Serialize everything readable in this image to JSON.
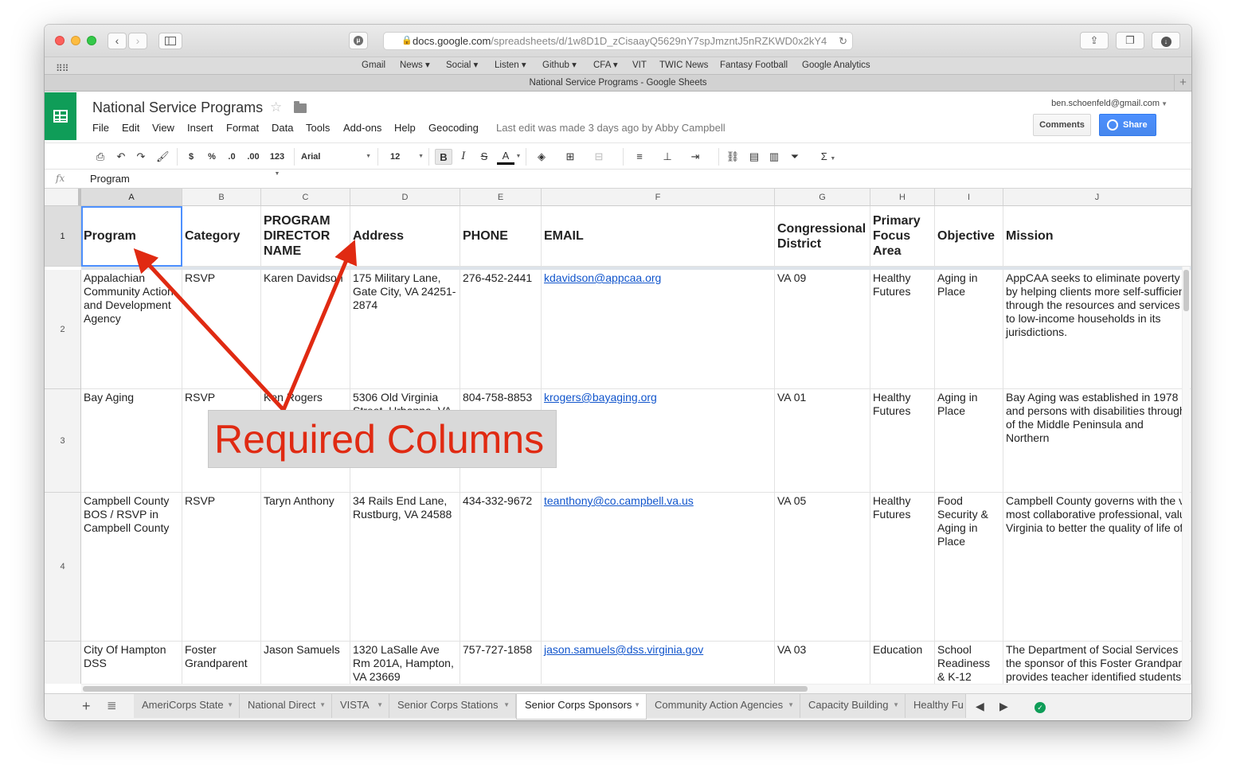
{
  "browser": {
    "url_host": "docs.google.com",
    "url_path": "/spreadsheets/d/1w8D1D_zCisaayQ5629nY7spJmzntJ5nRZKWD0x2kY4",
    "tab_title": "National Service Programs - Google Sheets",
    "bookmarks": [
      "Gmail",
      "News ▾",
      "Social ▾",
      "Listen ▾",
      "Github ▾",
      "CFA ▾",
      "VIT",
      "TWIC News",
      "Fantasy Football",
      "Google Analytics"
    ]
  },
  "doc": {
    "title": "National Service Programs",
    "menus": [
      "File",
      "Edit",
      "View",
      "Insert",
      "Format",
      "Data",
      "Tools",
      "Add-ons",
      "Help",
      "Geocoding"
    ],
    "last_edit": "Last edit was made 3 days ago by Abby Campbell",
    "account": "ben.schoenfeld@gmail.com",
    "comments_label": "Comments",
    "share_label": "Share"
  },
  "toolbar": {
    "currency": "$",
    "percent": "%",
    "dec_less": ".0",
    "dec_more": ".00",
    "format_more": "123",
    "font": "Arial",
    "font_size": "12",
    "bold": "B",
    "italic": "I",
    "strike": "S",
    "text_color": "A",
    "sigma": "Σ"
  },
  "formula_bar": {
    "fx": "fx",
    "value": "Program"
  },
  "grid": {
    "columns": [
      "A",
      "B",
      "C",
      "D",
      "E",
      "F",
      "G",
      "H",
      "I",
      "J"
    ],
    "row_numbers": [
      "1",
      "2",
      "3",
      "4"
    ],
    "headers": [
      "Program",
      "Category",
      "PROGRAM DIRECTOR NAME",
      "Address",
      "PHONE",
      "EMAIL",
      "Congressional District",
      "Primary Focus Area",
      "Objective",
      "Mission"
    ],
    "rows": [
      [
        "Appalachian Community Action and Development Agency",
        "RSVP",
        "Karen Davidson",
        "175 Military Lane, Gate City, VA 24251-2874",
        "276-452-2441",
        "kdavidson@appcaa.org",
        "VA 09",
        "Healthy Futures",
        "Aging in Place",
        "AppCAA seeks to eliminate poverty by helping clients more self-sufficient through the resources and services to low-income households in its jurisdictions."
      ],
      [
        "Bay Aging",
        "RSVP",
        "Ken Rogers",
        "5306 Old Virginia Street, Urbanna, VA",
        "804-758-8853",
        "krogers@bayaging.org",
        "VA 01",
        "Healthy Futures",
        "Aging in Place",
        "Bay Aging was established in 1978 and persons with disabilities through of the Middle Peninsula and Northern"
      ],
      [
        "Campbell County BOS  /  RSVP in Campbell County",
        "RSVP",
        "Taryn Anthony",
        "34 Rails End Lane, Rustburg, VA 24588",
        "434-332-9672",
        "teanthony@co.campbell.va.us",
        "VA 05",
        "Healthy Futures",
        "Food Security & Aging in Place",
        "Campbell County governs with the v most collaborative professional, valu Virginia to better the quality of life of"
      ],
      [
        "City Of Hampton DSS",
        "Foster Grandparent",
        "Jason Samuels",
        "1320 LaSalle Ave Rm 201A, Hampton, VA 23669",
        "757-727-1858",
        "jason.samuels@dss.virginia.gov",
        "VA 03",
        "Education",
        "School Readiness & K-12",
        "The Department of Social Services the sponsor of this Foster Grandpar provides teacher identified students"
      ]
    ]
  },
  "sheet_tabs": [
    "AmeriCorps State",
    "National Direct",
    "VISTA",
    "Senior Corps Stations",
    "Senior Corps Sponsors",
    "Community Action Agencies",
    "Capacity Building",
    "Healthy Fu"
  ],
  "active_sheet": "Senior Corps Sponsors",
  "annotation": {
    "label": "Required Columns",
    "color": "#e02a12"
  }
}
